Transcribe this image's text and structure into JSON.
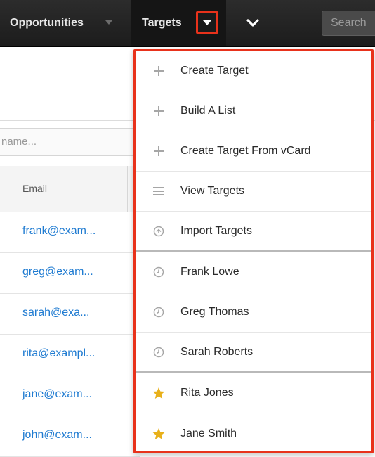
{
  "navbar": {
    "tabs": [
      {
        "label": "Opportunities"
      },
      {
        "label": "Targets"
      }
    ],
    "search": {
      "placeholder": "Search"
    }
  },
  "list_view": {
    "filter": {
      "placeholder": "name..."
    },
    "column_header": "Email",
    "emails": [
      "frank@exam...",
      "greg@exam...",
      "sarah@exa...",
      "rita@exampl...",
      "jane@exam...",
      "john@exam..."
    ]
  },
  "dropdown": {
    "actions": [
      {
        "label": "Create Target",
        "icon": "plus-icon"
      },
      {
        "label": "Build A List",
        "icon": "plus-icon"
      },
      {
        "label": "Create Target From vCard",
        "icon": "plus-icon"
      },
      {
        "label": "View Targets",
        "icon": "list-icon"
      },
      {
        "label": "Import Targets",
        "icon": "import-icon"
      }
    ],
    "recent": [
      {
        "label": "Frank Lowe",
        "icon": "clock-icon"
      },
      {
        "label": "Greg Thomas",
        "icon": "clock-icon"
      },
      {
        "label": "Sarah Roberts",
        "icon": "clock-icon"
      }
    ],
    "favorites": [
      {
        "label": "Rita Jones",
        "icon": "star-icon"
      },
      {
        "label": "Jane Smith",
        "icon": "star-icon"
      }
    ]
  },
  "colors": {
    "navbar_bg": "#222222",
    "highlight": "#e8321b",
    "link": "#1f7bd1",
    "star": "#e8b01a",
    "icon_gray": "#a6a6a6"
  }
}
